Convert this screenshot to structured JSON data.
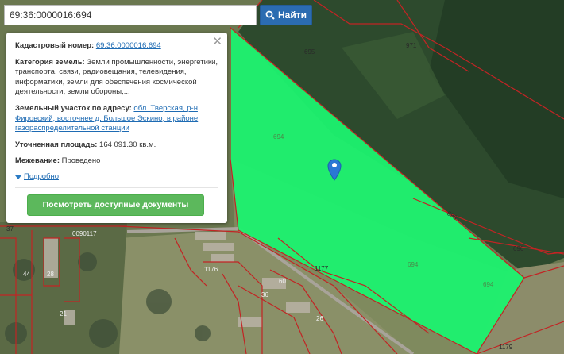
{
  "search": {
    "value": "69:36:0000016:694",
    "button_label": "Найти",
    "icon": "search-icon"
  },
  "popup": {
    "cadastral_label": "Кадастровый номер:",
    "cadastral_value": "69:36:0000016:694",
    "category_label": "Категория земель:",
    "category_value": "Земли промышленности, энергетики, транспорта, связи, радиовещания, телевидения, информатики, земли для обеспечения космической деятельности, земли обороны,...",
    "address_label": "Земельный участок по адресу:",
    "address_value": "обл. Тверская, р-н Фировский, восточнее д. Большое Эскино, в районе газораспределительной станции",
    "area_label": "Уточненная площадь:",
    "area_value": "164 091.30 кв.м.",
    "survey_label": "Межевание:",
    "survey_value": "Проведено",
    "more_label": "Подробно",
    "docs_button": "Посмотреть доступные документы",
    "close_icon": "close-icon"
  },
  "map": {
    "parcel_color": "#1cf26f",
    "boundary_color": "#c22424",
    "labels": [
      "695",
      "971",
      "694",
      "696",
      "1177",
      "694",
      "694",
      "696",
      "1179",
      "0090117",
      "37",
      "28",
      "44",
      "21",
      "26",
      "60",
      "36",
      "1176"
    ]
  }
}
